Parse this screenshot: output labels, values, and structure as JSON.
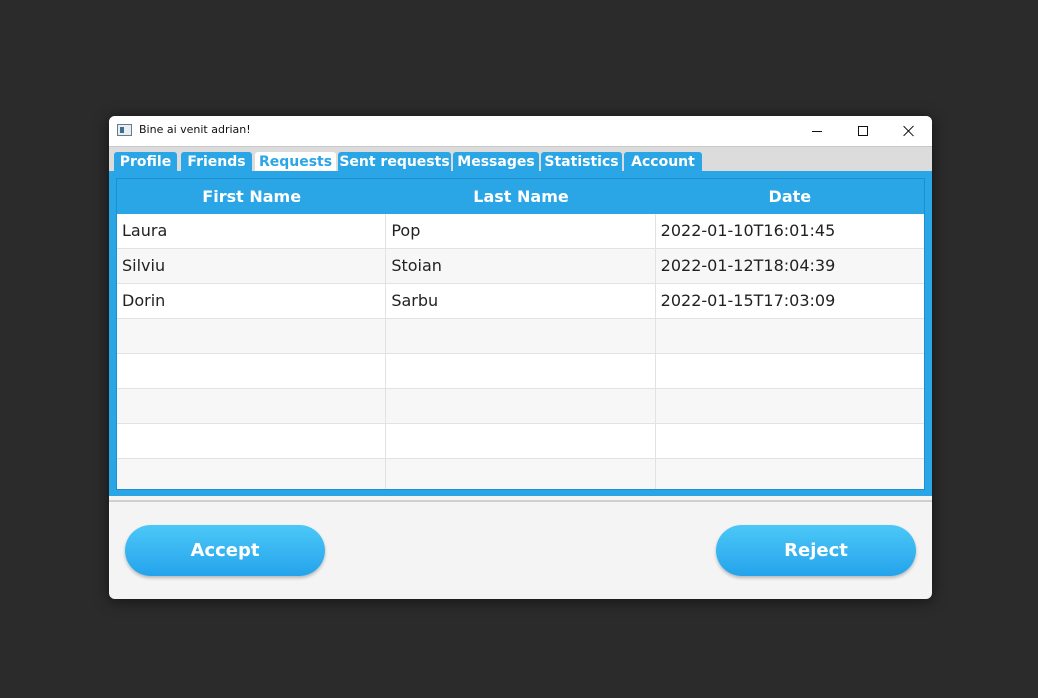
{
  "window": {
    "title": "Bine ai venit adrian!"
  },
  "tabs": [
    {
      "label": "Profile",
      "active": false
    },
    {
      "label": "Friends",
      "active": false
    },
    {
      "label": "Requests",
      "active": true
    },
    {
      "label": "Sent requests",
      "active": false
    },
    {
      "label": "Messages",
      "active": false
    },
    {
      "label": "Statistics",
      "active": false
    },
    {
      "label": "Account",
      "active": false
    }
  ],
  "table": {
    "columns": [
      "First Name",
      "Last Name",
      "Date"
    ],
    "rows": [
      [
        "Laura",
        "Pop",
        "2022-01-10T16:01:45"
      ],
      [
        "Silviu",
        "Stoian",
        "2022-01-12T18:04:39"
      ],
      [
        "Dorin",
        "Sarbu",
        "2022-01-15T17:03:09"
      ],
      [
        "",
        "",
        ""
      ],
      [
        "",
        "",
        ""
      ],
      [
        "",
        "",
        ""
      ],
      [
        "",
        "",
        ""
      ],
      [
        "",
        "",
        ""
      ]
    ]
  },
  "actions": {
    "accept_label": "Accept",
    "reject_label": "Reject"
  },
  "colors": {
    "accent": "#2aa6e6",
    "background": "#2b2b2b"
  }
}
